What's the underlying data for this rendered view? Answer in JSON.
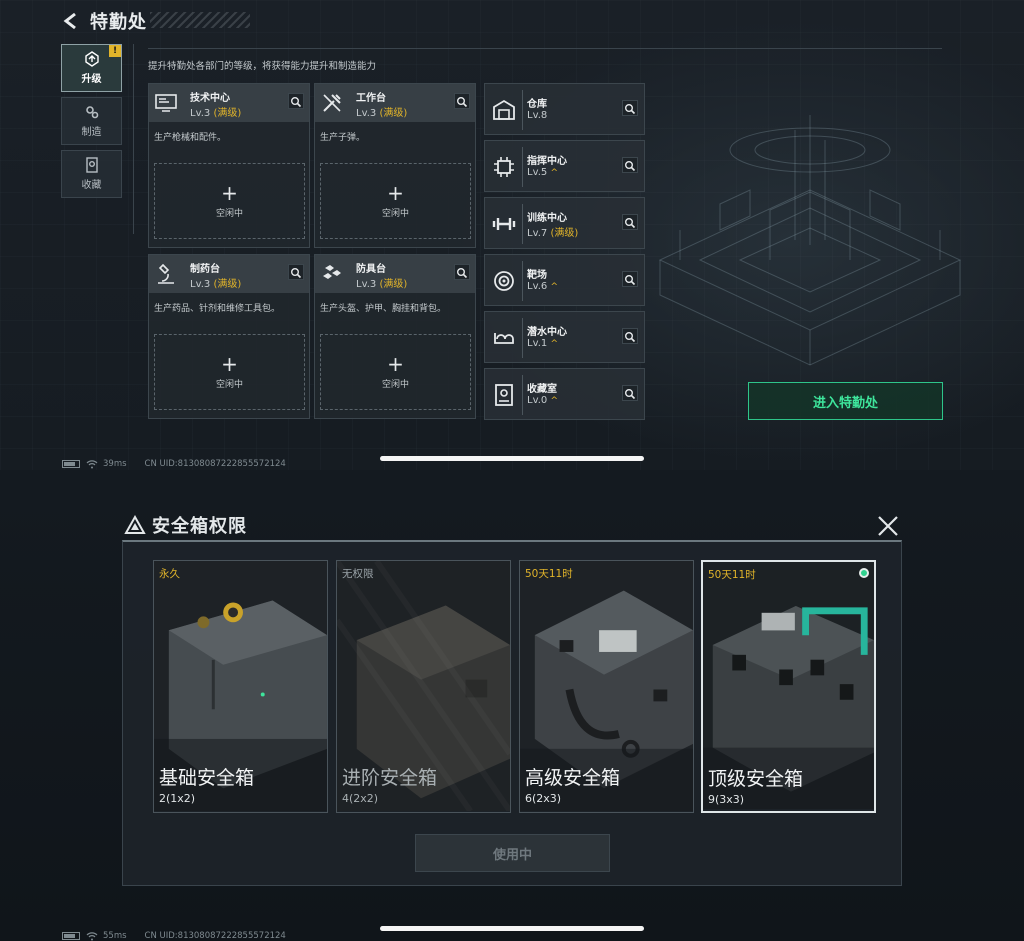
{
  "top": {
    "title": "特勤处",
    "subtitle": "提升特勤处各部门的等级，将获得能力提升和制造能力",
    "tabs": [
      {
        "label": "升级",
        "badge": "!"
      },
      {
        "label": "制造"
      },
      {
        "label": "收藏"
      }
    ],
    "benches": [
      {
        "name": "技术中心",
        "level": "Lv.3",
        "max": "(满级)",
        "desc": "生产枪械和配件。",
        "slot_plus": "+",
        "slot_text": "空闲中",
        "icon": "computer-icon"
      },
      {
        "name": "工作台",
        "level": "Lv.3",
        "max": "(满级)",
        "desc": "生产子弹。",
        "slot_plus": "+",
        "slot_text": "空闲中",
        "icon": "tools-icon"
      },
      {
        "name": "制药台",
        "level": "Lv.3",
        "max": "(满级)",
        "desc": "生产药品、针剂和维修工具包。",
        "slot_plus": "+",
        "slot_text": "空闲中",
        "icon": "microscope-icon"
      },
      {
        "name": "防具台",
        "level": "Lv.3",
        "max": "(满级)",
        "desc": "生产头盔、护甲、胸挂和背包。",
        "slot_plus": "+",
        "slot_text": "空闲中",
        "icon": "armor-icon"
      }
    ],
    "facilities": [
      {
        "name": "仓库",
        "level": "Lv.8",
        "icon": "warehouse-icon"
      },
      {
        "name": "指挥中心",
        "level": "Lv.5",
        "up": "^",
        "icon": "chip-icon"
      },
      {
        "name": "训练中心",
        "level": "Lv.7",
        "max": "(满级)",
        "icon": "dumbbell-icon"
      },
      {
        "name": "靶场",
        "level": "Lv.6",
        "up": "^",
        "icon": "target-icon"
      },
      {
        "name": "潜水中心",
        "level": "Lv.1",
        "up": "^",
        "icon": "diving-icon"
      },
      {
        "name": "收藏室",
        "level": "Lv.0",
        "up": "^",
        "icon": "display-case-icon"
      }
    ],
    "enter_label": "进入特勤处",
    "status": {
      "ping": "39ms",
      "uid": "CN UID:81308087222855572124"
    }
  },
  "bottom": {
    "title": "安全箱权限",
    "cases": [
      {
        "tag": "永久",
        "name": "基础安全箱",
        "size": "2(1x2)"
      },
      {
        "tag": "无权限",
        "name": "进阶安全箱",
        "size": "4(2x2)"
      },
      {
        "tag": "50天11时",
        "name": "高级安全箱",
        "size": "6(2x3)"
      },
      {
        "tag": "50天11时",
        "name": "顶级安全箱",
        "size": "9(3x3)",
        "selected": true
      }
    ],
    "use_label": "使用中",
    "status": {
      "ping": "55ms",
      "uid": "CN UID:81308087222855572124"
    }
  },
  "colors": {
    "accent_green": "#3ee59c",
    "max_gold": "#e1b42a"
  }
}
